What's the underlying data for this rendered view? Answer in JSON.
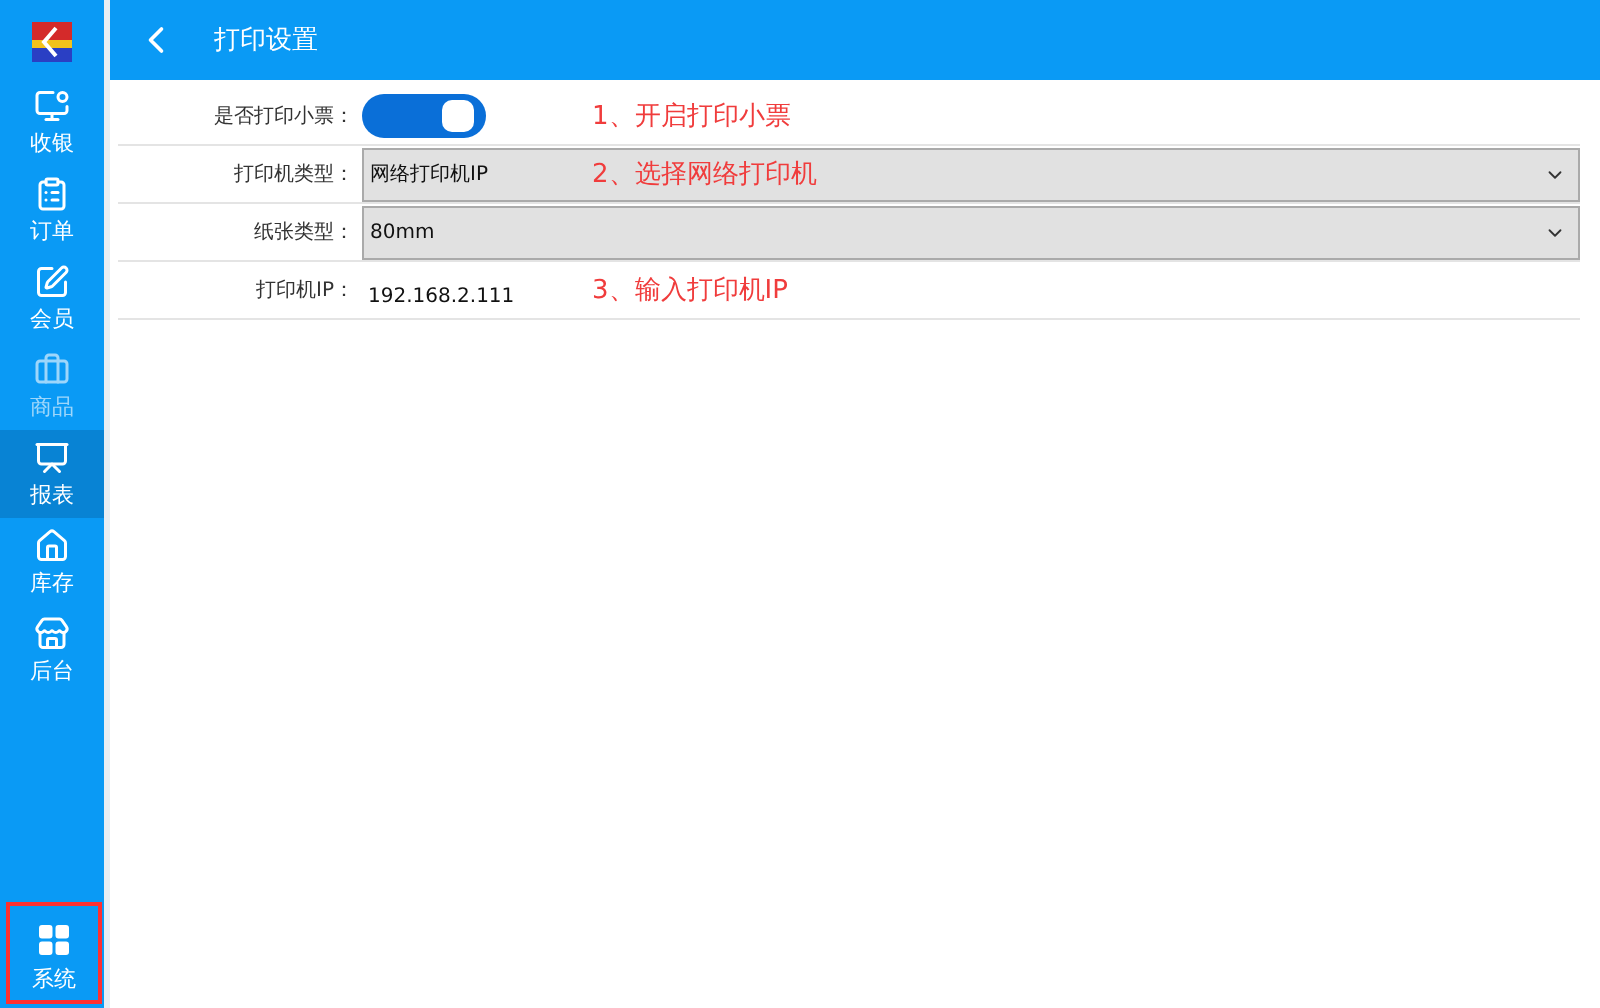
{
  "header": {
    "title": "打印设置"
  },
  "sidebar": {
    "items": [
      {
        "label": "收银",
        "kind": "cashier",
        "selected": false,
        "disabled": false
      },
      {
        "label": "订单",
        "kind": "orders",
        "selected": false,
        "disabled": false
      },
      {
        "label": "会员",
        "kind": "members",
        "selected": false,
        "disabled": false
      },
      {
        "label": "商品",
        "kind": "goods",
        "selected": false,
        "disabled": true
      },
      {
        "label": "报表",
        "kind": "reports",
        "selected": true,
        "disabled": false
      },
      {
        "label": "库存",
        "kind": "stock",
        "selected": false,
        "disabled": false
      },
      {
        "label": "后台",
        "kind": "admin",
        "selected": false,
        "disabled": false
      }
    ],
    "bottom_item": {
      "label": "系统",
      "highlighted": true
    }
  },
  "settings": [
    {
      "kind": "toggle",
      "label": "是否打印小票：",
      "on": true,
      "annotation": "1、开启打印小票"
    },
    {
      "kind": "select",
      "label": "打印机类型：",
      "value": "网络打印机IP",
      "annotation": "2、选择网络打印机"
    },
    {
      "kind": "select",
      "label": "纸张类型：",
      "value": "80mm"
    },
    {
      "kind": "text",
      "label": "打印机IP：",
      "value": "192.168.2.111",
      "annotation": "3、输入打印机IP"
    }
  ]
}
